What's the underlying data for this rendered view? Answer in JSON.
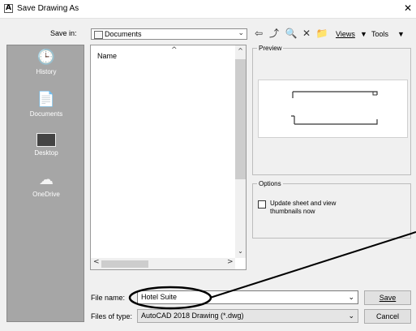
{
  "window": {
    "title": "Save Drawing As",
    "close_glyph": "✕",
    "app_icon_glyph": "A"
  },
  "toolbar": {
    "save_in_label": "Save in:",
    "save_in_value": "Documents",
    "views_label": "Views",
    "tools_label": "Tools",
    "back_glyph": "⇦",
    "up_glyph": "⤴",
    "search_glyph": "🔍",
    "delete_glyph": "✕",
    "new_folder_glyph": "📁"
  },
  "places": [
    {
      "label": "History",
      "icon": "history-icon"
    },
    {
      "label": "Documents",
      "icon": "documents-icon"
    },
    {
      "label": "Desktop",
      "icon": "desktop-icon"
    },
    {
      "label": "OneDrive",
      "icon": "onedrive-icon"
    }
  ],
  "file_list": {
    "column_name": "Name"
  },
  "preview": {
    "title": "Preview"
  },
  "options": {
    "title": "Options",
    "update_thumbnails_label": "Update sheet and view thumbnails now",
    "update_thumbnails_checked": false
  },
  "form": {
    "file_name_label": "File name:",
    "file_name_value": "Hotel Suite",
    "file_type_label": "Files of type:",
    "file_type_value": "AutoCAD 2018 Drawing (*.dwg)",
    "save_label": "Save",
    "cancel_label": "Cancel"
  },
  "colors": {
    "places_bg": "#a6a6a6",
    "dialog_bg": "#f0f0f0",
    "callout": "#000000"
  }
}
